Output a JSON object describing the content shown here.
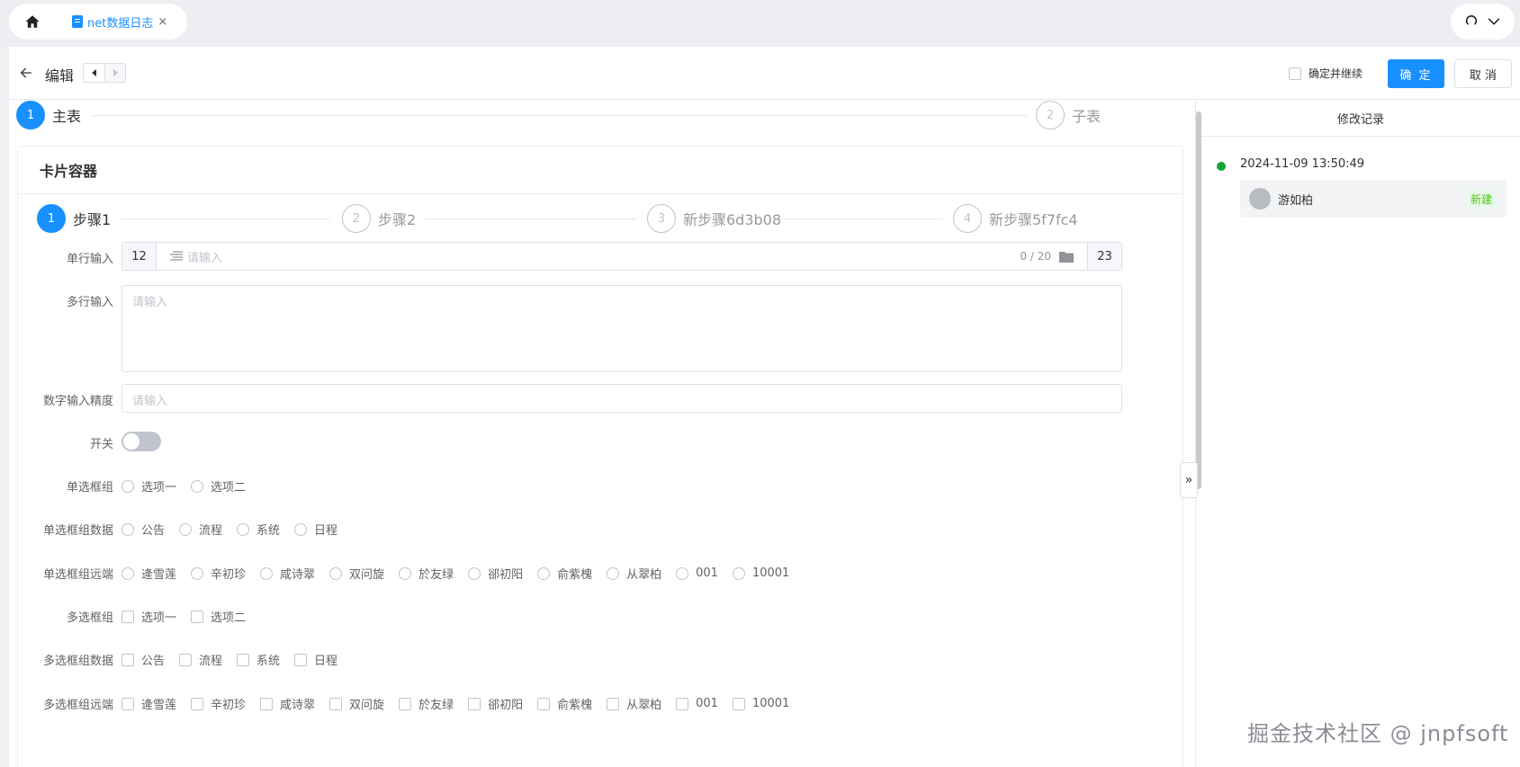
{
  "tabs": {
    "active_tab": "net数据日志",
    "close_glyph": "×"
  },
  "header": {
    "title": "编辑",
    "continue_label": "确定并继续",
    "confirm_label": "确 定",
    "cancel_label": "取 消"
  },
  "top_steps": [
    {
      "num": "1",
      "label": "主表",
      "active": true
    },
    {
      "num": "2",
      "label": "子表",
      "active": false
    }
  ],
  "card": {
    "title": "卡片容器",
    "steps": [
      {
        "num": "1",
        "label": "步骤1",
        "active": true
      },
      {
        "num": "2",
        "label": "步骤2",
        "active": false
      },
      {
        "num": "3",
        "label": "新步骤6d3b08",
        "active": false
      },
      {
        "num": "4",
        "label": "新步骤5f7fc4",
        "active": false
      }
    ]
  },
  "form": {
    "single_line": {
      "label": "单行输入",
      "prepend": "12",
      "placeholder": "请输入",
      "count": "0 / 20",
      "append": "23"
    },
    "multi_line": {
      "label": "多行输入",
      "placeholder": "请输入"
    },
    "number": {
      "label": "数字输入精度",
      "placeholder": "请输入"
    },
    "switch": {
      "label": "开关"
    },
    "radio_group": {
      "label": "单选框组",
      "options": [
        "选项一",
        "选项二"
      ]
    },
    "radio_data": {
      "label": "单选框组数据",
      "options": [
        "公告",
        "流程",
        "系统",
        "日程"
      ]
    },
    "radio_remote": {
      "label": "单选框组远端",
      "options": [
        "逄雪莲",
        "辛初珍",
        "咸诗翠",
        "双问旋",
        "於友绿",
        "郤初阳",
        "俞紫槐",
        "从翠柏",
        "001",
        "10001"
      ]
    },
    "check_group": {
      "label": "多选框组",
      "options": [
        "选项一",
        "选项二"
      ]
    },
    "check_data": {
      "label": "多选框组数据",
      "options": [
        "公告",
        "流程",
        "系统",
        "日程"
      ]
    },
    "check_remote": {
      "label": "多选框组远端",
      "options": [
        "逄雪莲",
        "辛初珍",
        "咸诗翠",
        "双问旋",
        "於友绿",
        "郤初阳",
        "俞紫槐",
        "从翠柏",
        "001",
        "10001"
      ]
    }
  },
  "log_panel": {
    "title": "修改记录",
    "entries": [
      {
        "time": "2024-11-09 13:50:49",
        "user": "游如柏",
        "badge": "新建"
      }
    ]
  },
  "collapse_glyph": "»",
  "watermark": "掘金技术社区 @ jnpfsoft",
  "colors": {
    "primary": "#1890ff",
    "success": "#13a33a",
    "badge_text": "#52c41a"
  },
  "icons": [
    "home-icon",
    "document-icon",
    "refresh-icon",
    "chevron-down-icon",
    "arrow-left-icon",
    "caret-left-icon",
    "caret-right-icon",
    "text-align-icon",
    "folder-icon"
  ]
}
